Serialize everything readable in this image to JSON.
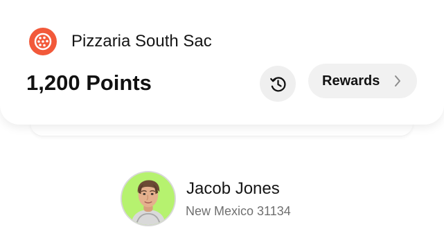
{
  "store": {
    "name": "Pizzaria South Sac",
    "logo_icon": "pizza-logo-icon",
    "brand_color": "#f2593a"
  },
  "loyalty": {
    "points_text": "1,200 Points",
    "history_icon": "history-icon",
    "rewards_label": "Rewards",
    "rewards_icon": "chevron-right-icon"
  },
  "user": {
    "name": "Jacob Jones",
    "location": "New Mexico 31134",
    "avatar_background": "#b6f26f",
    "avatar_icon": "profile-photo"
  }
}
